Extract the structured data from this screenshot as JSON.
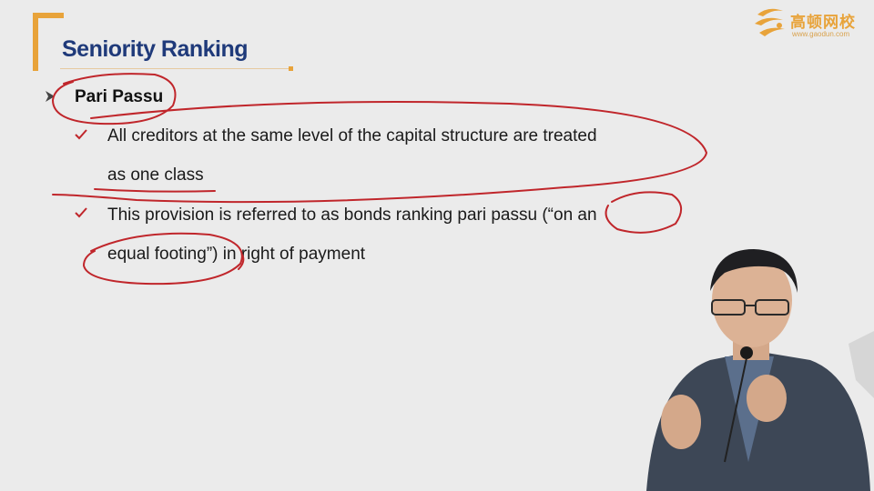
{
  "slide": {
    "title": "Seniority Ranking",
    "heading": "Pari Passu",
    "points": [
      {
        "line1": "All creditors at the same level of the capital structure are treated",
        "line2": "as one class"
      },
      {
        "line1": "This provision is referred to as bonds ranking pari passu (“on an",
        "line2": "equal footing”) in right of payment"
      }
    ]
  },
  "brand": {
    "name": "高顿网校",
    "url": "www.gaodun.com"
  },
  "colors": {
    "accent": "#e8a33a",
    "title": "#1f3a7a",
    "annotation": "#c0262b",
    "check": "#c0262b"
  }
}
